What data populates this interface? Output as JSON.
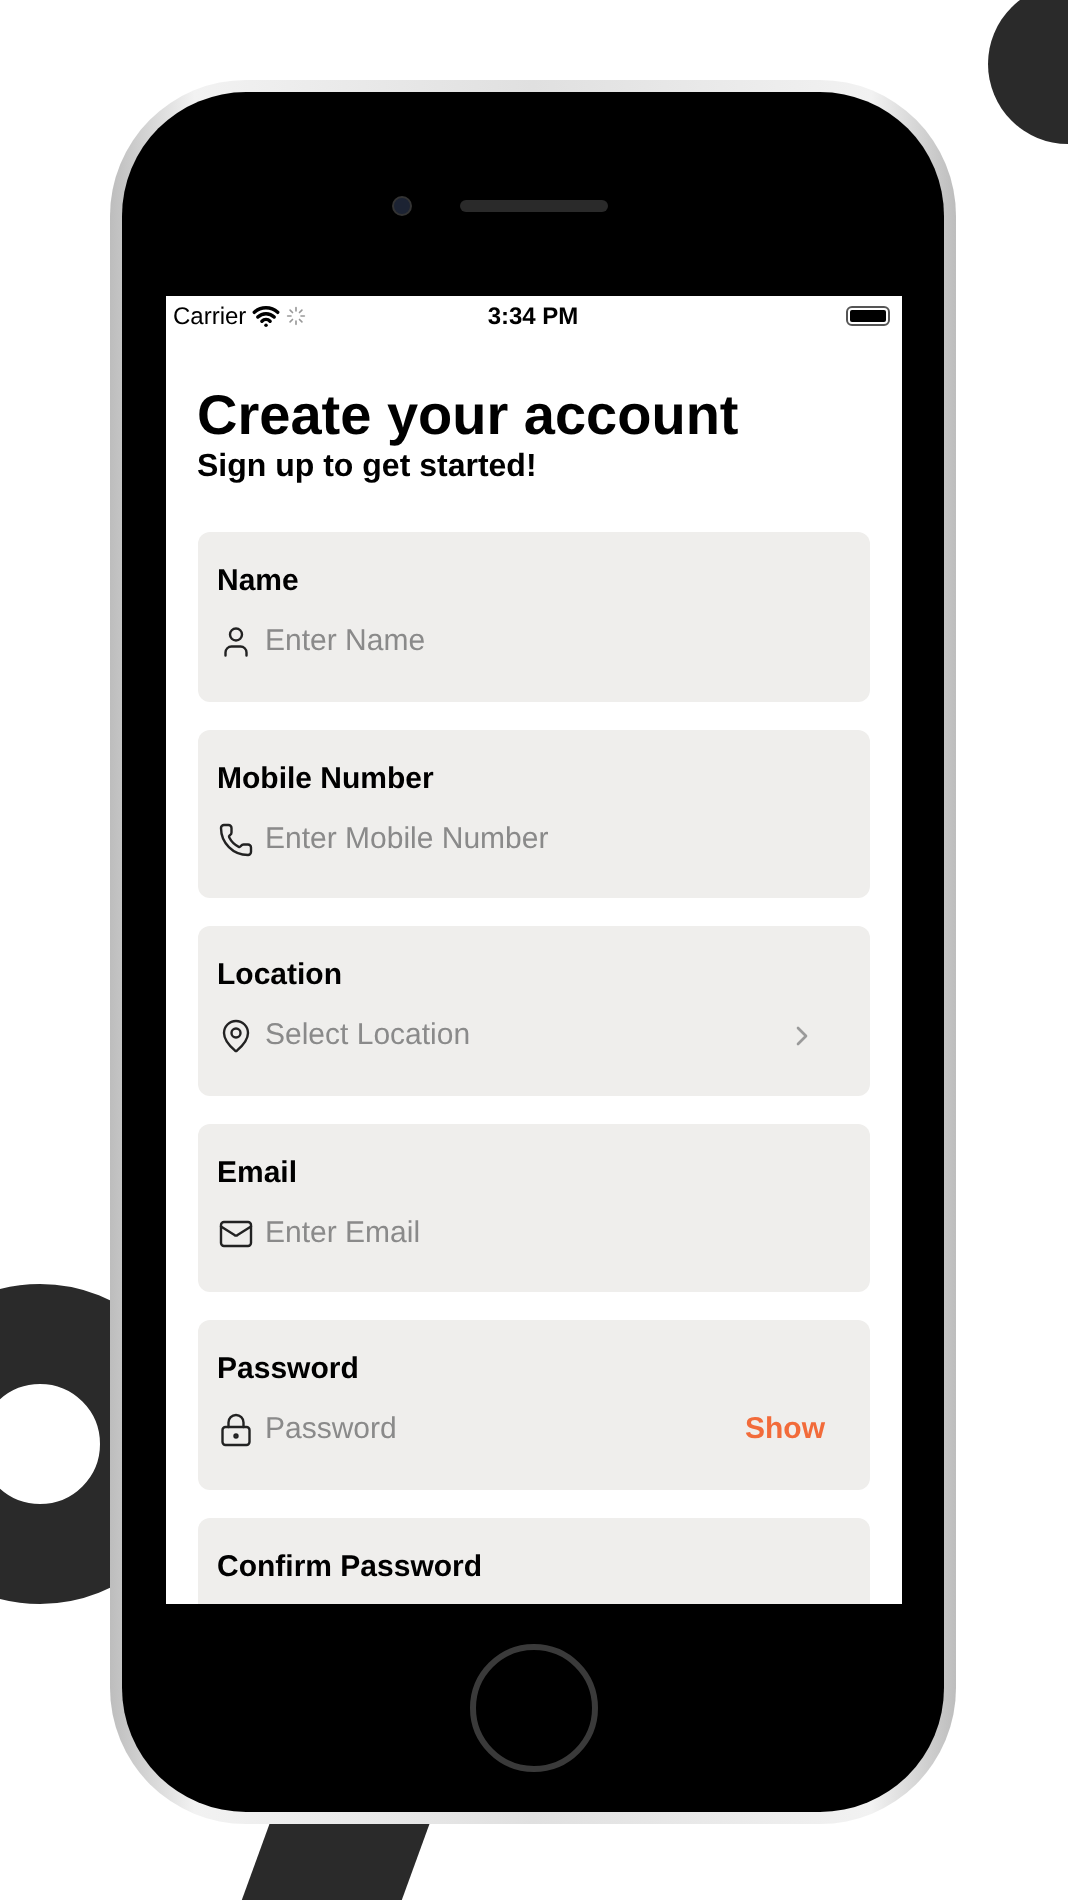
{
  "status_bar": {
    "carrier": "Carrier",
    "time": "3:34 PM"
  },
  "header": {
    "title": "Create your account",
    "subtitle": "Sign up to get started!"
  },
  "fields": [
    {
      "kind": "name",
      "label": "Name",
      "placeholder": "Enter Name"
    },
    {
      "kind": "phone",
      "label": "Mobile Number",
      "placeholder": "Enter Mobile Number"
    },
    {
      "kind": "location",
      "label": "Location",
      "placeholder": "Select Location"
    },
    {
      "kind": "email",
      "label": "Email",
      "placeholder": "Enter Email"
    },
    {
      "kind": "password",
      "label": "Password",
      "placeholder": "Password",
      "action": "Show"
    },
    {
      "kind": "password",
      "label": "Confirm Password"
    }
  ]
}
